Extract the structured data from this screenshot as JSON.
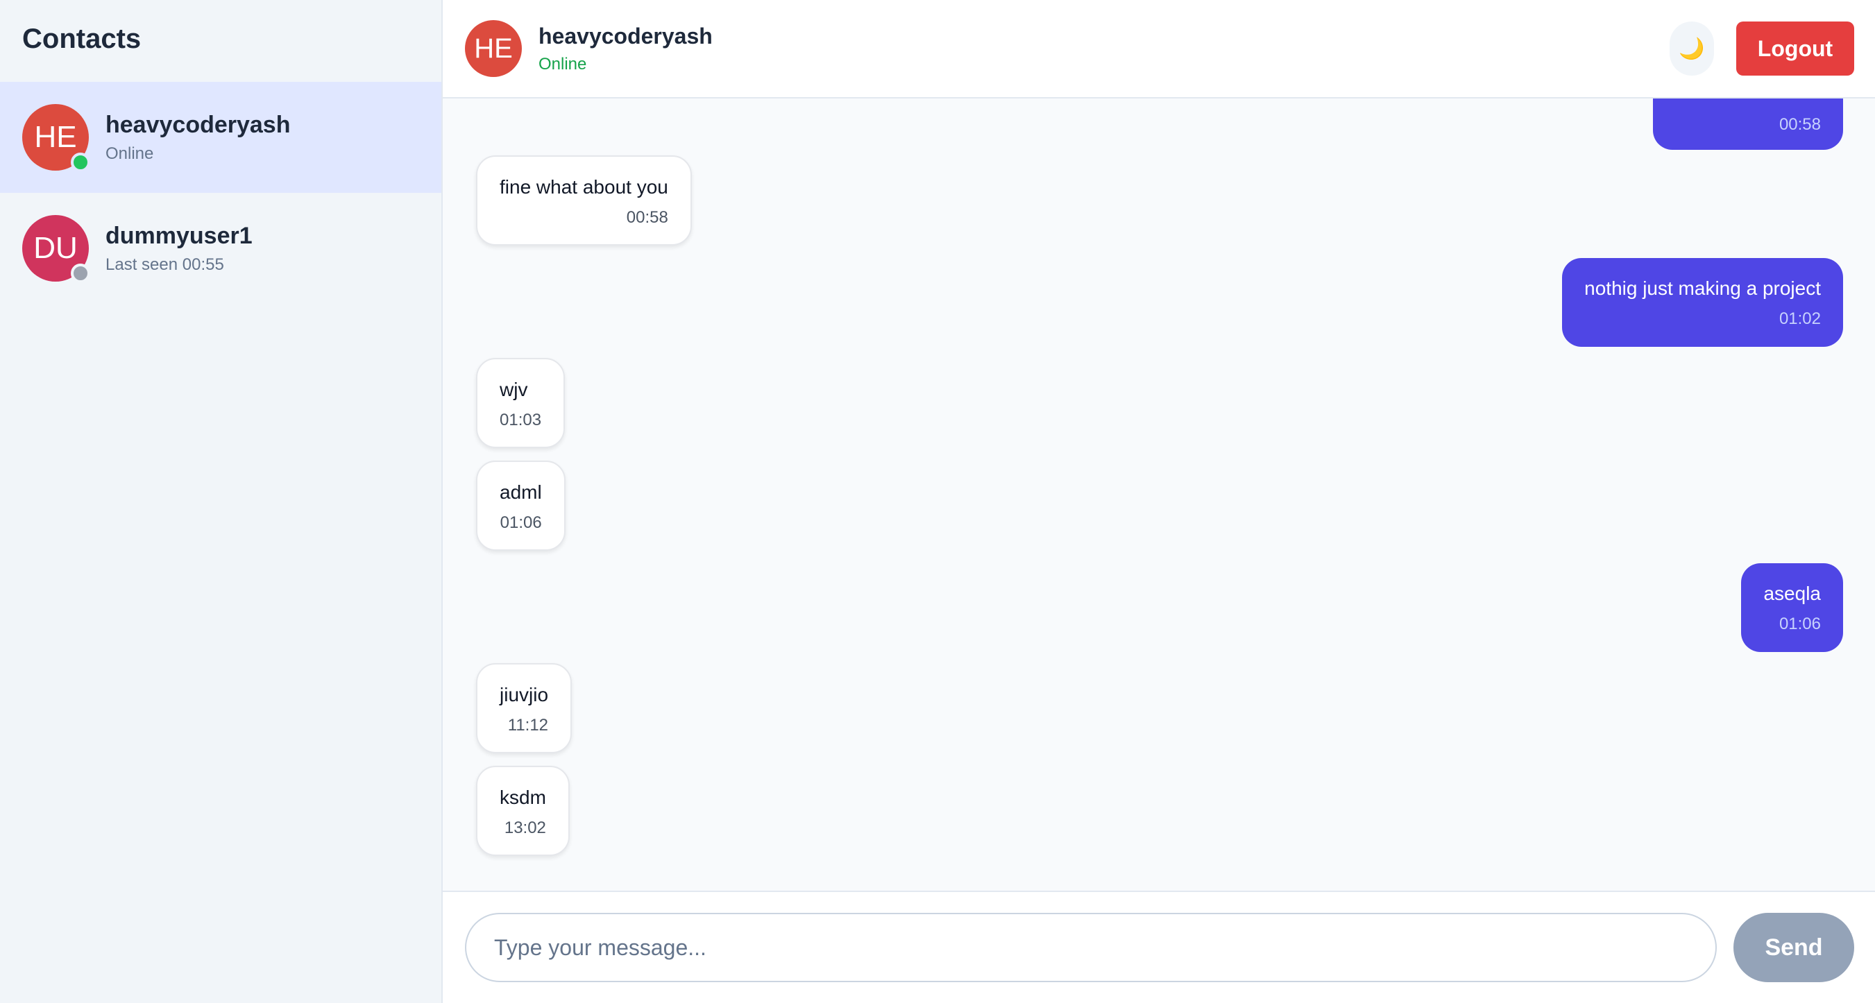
{
  "sidebar": {
    "title": "Contacts",
    "contacts": [
      {
        "initials": "HE",
        "name": "heavycoderyash",
        "status": "Online",
        "avatar_color": "#dc4b3e",
        "status_color": "#22c55e",
        "active": true
      },
      {
        "initials": "DU",
        "name": "dummyuser1",
        "status": "Last seen 00:55",
        "avatar_color": "#d0345d",
        "status_color": "#9ca3af",
        "active": false
      }
    ]
  },
  "header": {
    "initials": "HE",
    "name": "heavycoderyash",
    "status": "Online",
    "avatar_color": "#dc4b3e",
    "theme_icon": "moon-icon",
    "theme_glyph": "🌙",
    "logout_label": "Logout"
  },
  "messages": [
    {
      "direction": "out",
      "text": "",
      "time": "00:58"
    },
    {
      "direction": "in",
      "text": "fine what about you",
      "time": "00:58"
    },
    {
      "direction": "out",
      "text": "nothig just making a project",
      "time": "01:02"
    },
    {
      "direction": "in",
      "text": "wjv",
      "time": "01:03"
    },
    {
      "direction": "in",
      "text": "adml",
      "time": "01:06"
    },
    {
      "direction": "out",
      "text": "aseqla",
      "time": "01:06"
    },
    {
      "direction": "in",
      "text": "jiuvjio",
      "time": "11:12"
    },
    {
      "direction": "in",
      "text": "ksdm",
      "time": "13:02"
    }
  ],
  "composer": {
    "placeholder": "Type your message...",
    "value": "",
    "send_label": "Send"
  },
  "colors": {
    "accent": "#4f46e5",
    "logout": "#e53e3e",
    "send_disabled": "#94a3b8",
    "online": "#16a34a"
  }
}
